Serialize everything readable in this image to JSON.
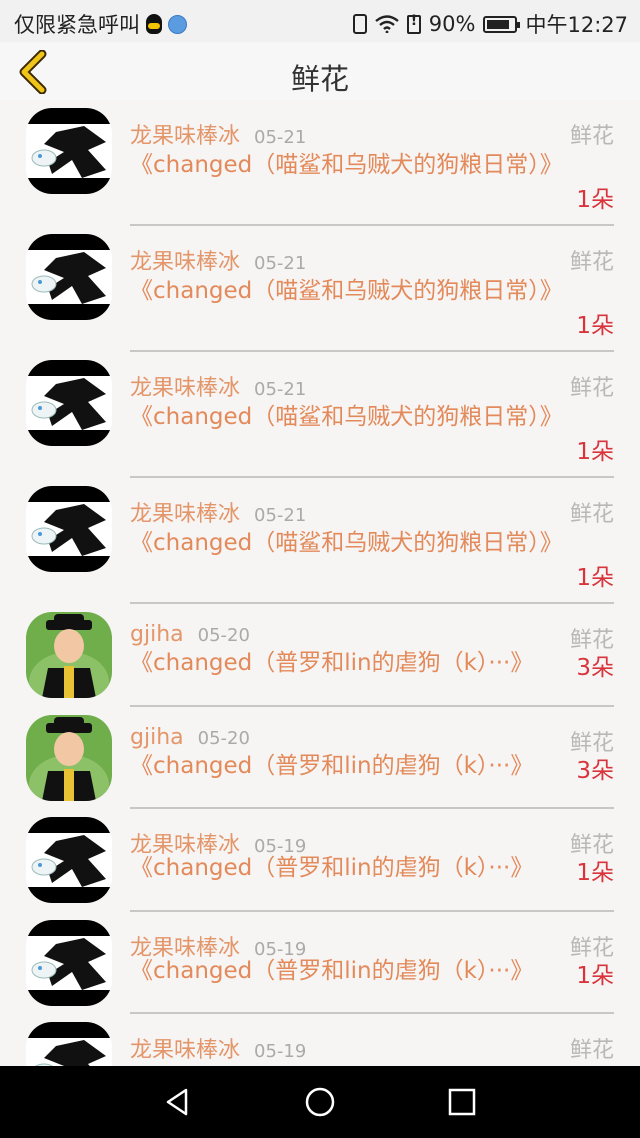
{
  "status": {
    "carrier": "仅限紧急呼叫",
    "battery": "90%",
    "time": "中午12:27"
  },
  "header": {
    "title": "鲜花"
  },
  "items": [
    {
      "name": "龙果味棒冰",
      "date": "05-21",
      "type": "鲜花",
      "message": "《changed（喵鲨和乌贼犬的狗粮日常）》",
      "count": "1朵",
      "avatar": "cat"
    },
    {
      "name": "龙果味棒冰",
      "date": "05-21",
      "type": "鲜花",
      "message": "《changed（喵鲨和乌贼犬的狗粮日常）》",
      "count": "1朵",
      "avatar": "cat"
    },
    {
      "name": "龙果味棒冰",
      "date": "05-21",
      "type": "鲜花",
      "message": "《changed（喵鲨和乌贼犬的狗粮日常）》",
      "count": "1朵",
      "avatar": "cat"
    },
    {
      "name": "龙果味棒冰",
      "date": "05-21",
      "type": "鲜花",
      "message": "《changed（喵鲨和乌贼犬的狗粮日常）》",
      "count": "1朵",
      "avatar": "cat"
    },
    {
      "name": "gjiha",
      "date": "05-20",
      "type": "鲜花",
      "message": "《changed（普罗和lin的虐狗（k）···》",
      "count": "3朵",
      "avatar": "child"
    },
    {
      "name": "gjiha",
      "date": "05-20",
      "type": "鲜花",
      "message": "《changed（普罗和lin的虐狗（k）···》",
      "count": "3朵",
      "avatar": "child"
    },
    {
      "name": "龙果味棒冰",
      "date": "05-19",
      "type": "鲜花",
      "message": "《changed（普罗和lin的虐狗（k）···》",
      "count": "1朵",
      "avatar": "cat"
    },
    {
      "name": "龙果味棒冰",
      "date": "05-19",
      "type": "鲜花",
      "message": "《changed（普罗和lin的虐狗（k）···》",
      "count": "1朵",
      "avatar": "cat"
    },
    {
      "name": "龙果味棒冰",
      "date": "05-19",
      "type": "鲜花",
      "message": "",
      "count": "",
      "avatar": "cat"
    }
  ]
}
